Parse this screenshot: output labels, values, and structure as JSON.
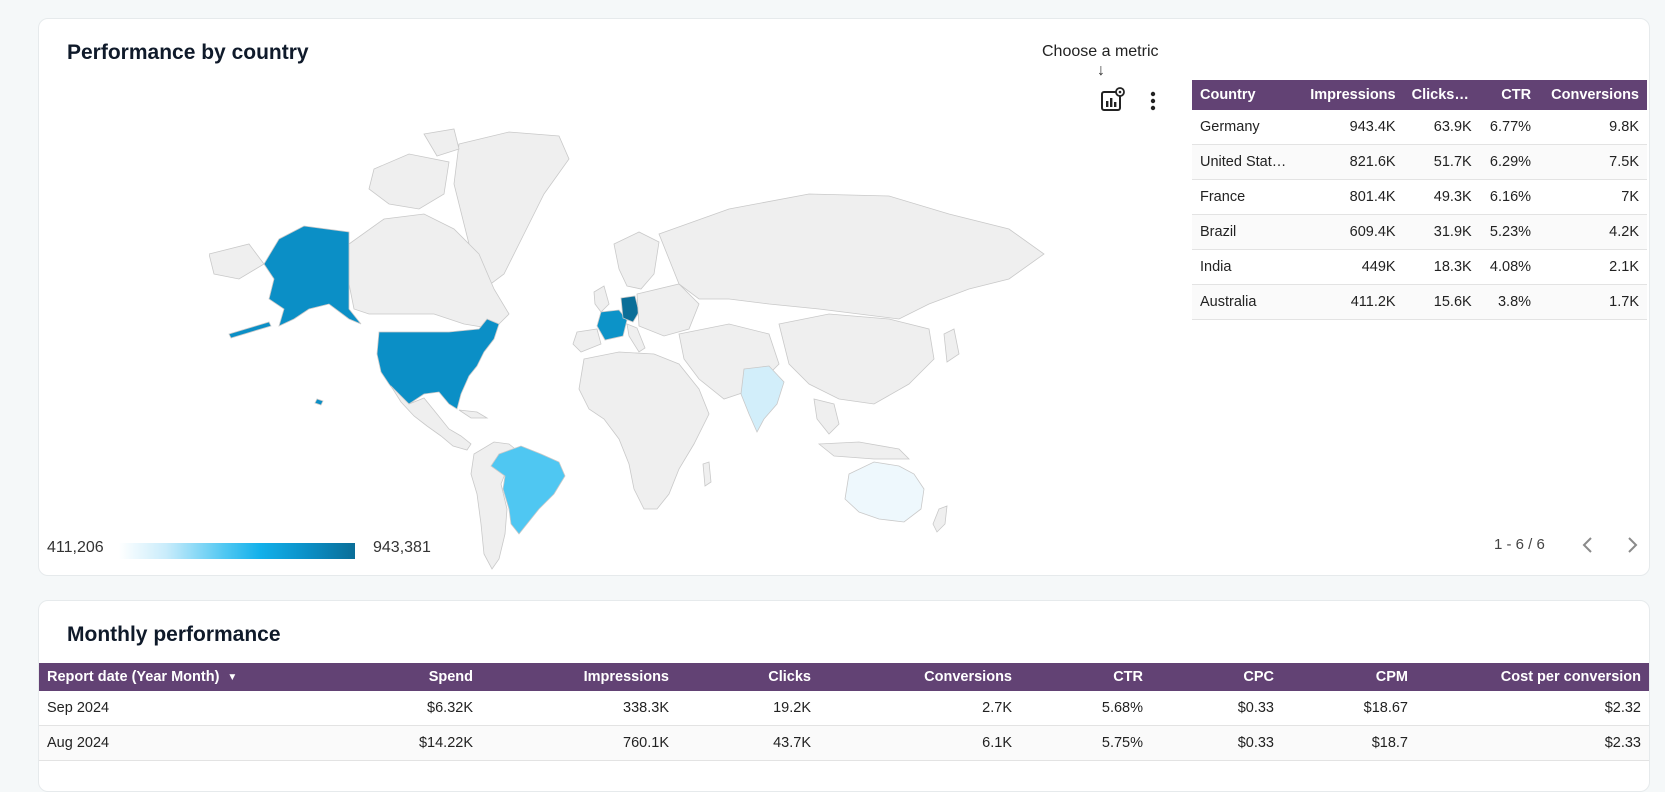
{
  "performance": {
    "title": "Performance by country",
    "metric_hint": "Choose a metric",
    "metric_arrow": "↓",
    "legend": {
      "min": "411,206",
      "max": "943,381"
    },
    "map_colors": {
      "empty": "#efefef",
      "border": "#c9c9c9",
      "germany": "#0a6e98",
      "united_states": "#0b8fc6",
      "france": "#0c93c8",
      "brazil": "#4fc7f2",
      "india": "#d2eefa",
      "australia": "#eef8fd"
    },
    "table": {
      "headers": [
        "Country",
        "Impressions",
        "Clicks…",
        "CTR",
        "Conversions"
      ],
      "rows": [
        [
          "Germany",
          "943.4K",
          "63.9K",
          "6.77%",
          "9.8K"
        ],
        [
          "United Stat…",
          "821.6K",
          "51.7K",
          "6.29%",
          "7.5K"
        ],
        [
          "France",
          "801.4K",
          "49.3K",
          "6.16%",
          "7K"
        ],
        [
          "Brazil",
          "609.4K",
          "31.9K",
          "5.23%",
          "4.2K"
        ],
        [
          "India",
          "449K",
          "18.3K",
          "4.08%",
          "2.1K"
        ],
        [
          "Australia",
          "411.2K",
          "15.6K",
          "3.8%",
          "1.7K"
        ]
      ]
    },
    "pager": "1 - 6 / 6"
  },
  "monthly": {
    "title": "Monthly performance",
    "headers": [
      "Report date (Year Month)",
      "Spend",
      "Impressions",
      "Clicks",
      "Conversions",
      "CTR",
      "CPC",
      "CPM",
      "Cost per conversion"
    ],
    "rows": [
      [
        "Sep 2024",
        "$6.32K",
        "338.3K",
        "19.2K",
        "2.7K",
        "5.68%",
        "$0.33",
        "$18.67",
        "$2.32"
      ],
      [
        "Aug 2024",
        "$14.22K",
        "760.1K",
        "43.7K",
        "6.1K",
        "5.75%",
        "$0.33",
        "$18.7",
        "$2.33"
      ]
    ]
  },
  "accent_color": "#624274"
}
